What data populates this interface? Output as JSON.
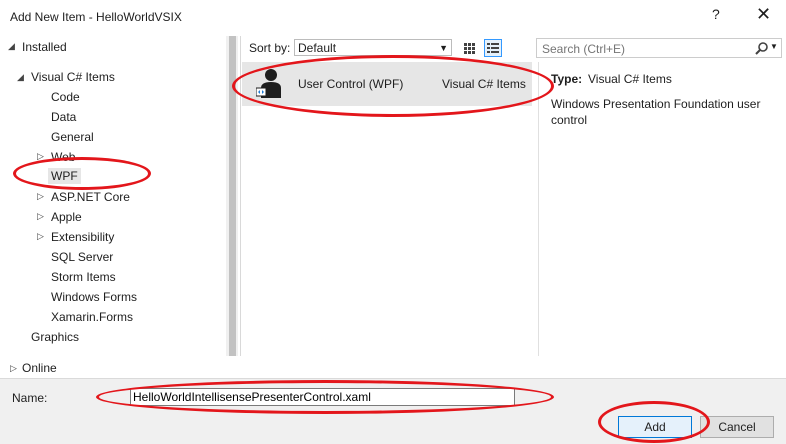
{
  "window": {
    "title": "Add New Item - HelloWorldVSIX",
    "help_label": "?",
    "close_label": "✕"
  },
  "tree": {
    "installed_label": "Installed",
    "root_label": "Visual C# Items",
    "items": [
      {
        "label": "Code",
        "expandable": false
      },
      {
        "label": "Data",
        "expandable": false
      },
      {
        "label": "General",
        "expandable": false
      },
      {
        "label": "Web",
        "expandable": true
      },
      {
        "label": "WPF",
        "expandable": false,
        "selected": true
      },
      {
        "label": "ASP.NET Core",
        "expandable": true
      },
      {
        "label": "Apple",
        "expandable": true
      },
      {
        "label": "Extensibility",
        "expandable": true
      },
      {
        "label": "SQL Server",
        "expandable": false
      },
      {
        "label": "Storm Items",
        "expandable": false
      },
      {
        "label": "Windows Forms",
        "expandable": false
      },
      {
        "label": "Xamarin.Forms",
        "expandable": false
      }
    ],
    "graphics_label": "Graphics",
    "online_label": "Online"
  },
  "sortbar": {
    "label": "Sort by:",
    "value": "Default"
  },
  "templates": [
    {
      "name": "User Control (WPF)",
      "category": "Visual C# Items"
    }
  ],
  "search": {
    "placeholder": "Search (Ctrl+E)"
  },
  "description": {
    "type_label": "Type:",
    "type_value": "Visual C# Items",
    "text": "Windows Presentation Foundation user control"
  },
  "bottom": {
    "name_label": "Name:",
    "name_value": "HelloWorldIntellisensePresenterControl.xaml",
    "add_label": "Add",
    "cancel_label": "Cancel"
  },
  "colors": {
    "annotation": "#e3161b",
    "accent": "#0078d7",
    "selection": "#e6e6e6"
  }
}
